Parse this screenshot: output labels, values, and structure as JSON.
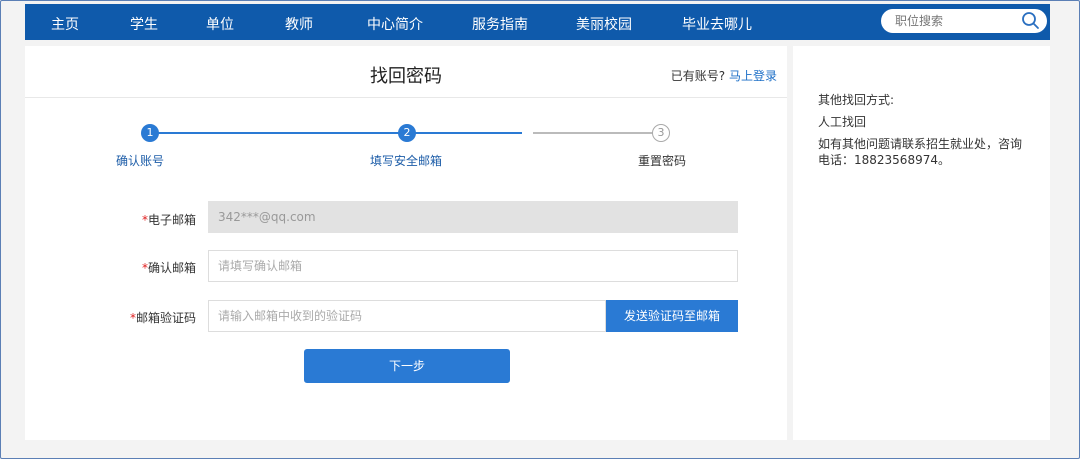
{
  "nav": {
    "items": [
      "主页",
      "学生",
      "单位",
      "教师",
      "中心简介",
      "服务指南",
      "美丽校园",
      "毕业去哪儿"
    ],
    "search_placeholder": "职位搜索"
  },
  "main": {
    "title": "找回密码",
    "login_hint": "已有账号?",
    "login_link": "马上登录"
  },
  "steps": [
    {
      "number": "1",
      "label": "确认账号",
      "state": "done"
    },
    {
      "number": "2",
      "label": "填写安全邮箱",
      "state": "current"
    },
    {
      "number": "3",
      "label": "重置密码",
      "state": "todo"
    }
  ],
  "form": {
    "email_label": "电子邮箱",
    "email_value": "342***@qq.com",
    "confirm_label": "确认邮箱",
    "confirm_placeholder": "请填写确认邮箱",
    "code_label": "邮箱验证码",
    "code_placeholder": "请输入邮箱中收到的验证码",
    "send_button": "发送验证码至邮箱",
    "next_button": "下一步",
    "required_mark": "*"
  },
  "side": {
    "heading": "其他找回方式:",
    "method": "人工找回",
    "contact_line1": "如有其他问题请联系招生就业处，咨询",
    "contact_line2": "电话：18823568974。"
  },
  "colors": {
    "nav_bg": "#0f5aab",
    "accent": "#2a7ad4",
    "required": "#e02020",
    "link": "#1d6fc7"
  }
}
